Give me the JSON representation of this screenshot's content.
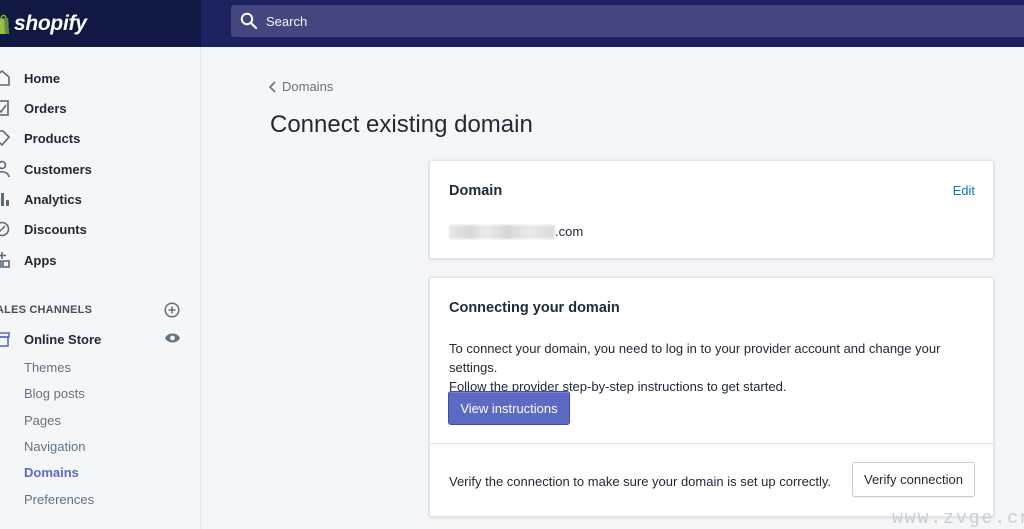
{
  "brand": {
    "wordmark": "shopify"
  },
  "search": {
    "placeholder": "Search"
  },
  "sidebar": {
    "items": [
      {
        "label": "Home",
        "icon": "home-icon"
      },
      {
        "label": "Orders",
        "icon": "orders-icon"
      },
      {
        "label": "Products",
        "icon": "tag-icon"
      },
      {
        "label": "Customers",
        "icon": "person-icon"
      },
      {
        "label": "Analytics",
        "icon": "bar-chart-icon"
      },
      {
        "label": "Discounts",
        "icon": "discount-icon"
      },
      {
        "label": "Apps",
        "icon": "apps-icon"
      }
    ],
    "sales_channels": {
      "label": "ALES CHANNELS",
      "online_store": "Online Store",
      "sub_items": [
        {
          "label": "Themes",
          "active": false
        },
        {
          "label": "Blog posts",
          "active": false
        },
        {
          "label": "Pages",
          "active": false
        },
        {
          "label": "Navigation",
          "active": false
        },
        {
          "label": "Domains",
          "active": true
        },
        {
          "label": "Preferences",
          "active": false
        }
      ]
    }
  },
  "main": {
    "breadcrumb": "Domains",
    "title": "Connect existing domain",
    "domain_card": {
      "title": "Domain",
      "edit_label": "Edit",
      "domain_suffix": ".com"
    },
    "connect_card": {
      "title": "Connecting your domain",
      "description_line1": "To connect your domain, you need to log in to your provider account and change your settings.",
      "description_line2": "Follow the provider step-by-step instructions to get started.",
      "primary_button": "View instructions",
      "verify_text": "Verify the connection to make sure your domain is set up correctly.",
      "secondary_button": "Verify connection"
    }
  },
  "watermark": "www.zvge.cn",
  "colors": {
    "topbar": "#1c2260",
    "brand_bg": "#111844",
    "search_bg": "#43467f",
    "accent": "#5c6ac4",
    "link": "#007ace"
  }
}
